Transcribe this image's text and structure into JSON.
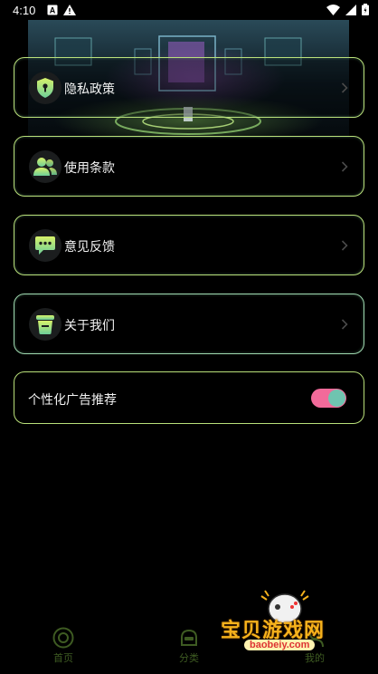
{
  "status_bar": {
    "time": "4:10"
  },
  "menu": {
    "items": [
      {
        "label": "隐私政策",
        "icon": "shield-icon"
      },
      {
        "label": "使用条款",
        "icon": "users-icon"
      },
      {
        "label": "意见反馈",
        "icon": "chat-bubble-icon"
      },
      {
        "label": "关于我们",
        "icon": "cup-icon"
      }
    ],
    "toggle_label": "个性化广告推荐",
    "toggle_on": true
  },
  "bottom_nav": {
    "items": [
      {
        "label": "首页"
      },
      {
        "label": "分类"
      },
      {
        "label": "我的"
      }
    ]
  },
  "watermark": {
    "title": "宝贝游戏网",
    "url": "baobeiy.com"
  },
  "colors": {
    "card_border": "#b9e07a",
    "toggle_track": "#f26a9a",
    "toggle_knob": "#6fc4b0",
    "nav_inactive": "#3e5b22"
  }
}
